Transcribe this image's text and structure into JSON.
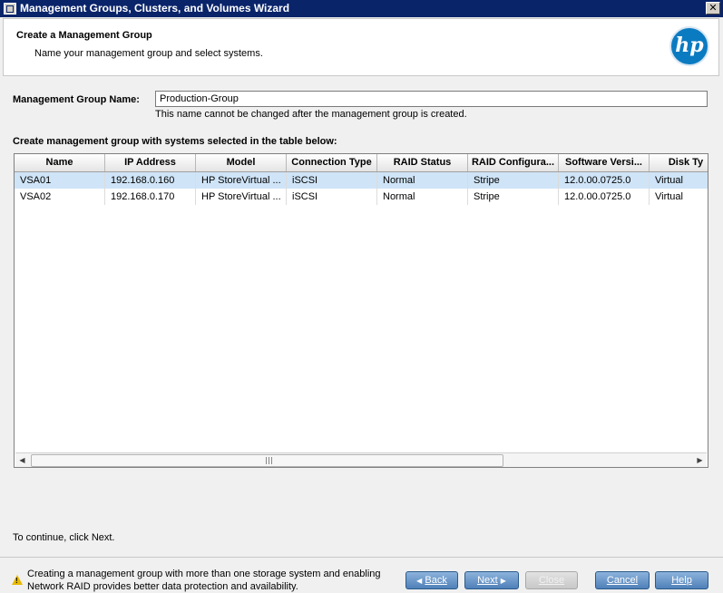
{
  "window": {
    "title": "Management Groups, Clusters, and Volumes Wizard",
    "close_glyph": "✕"
  },
  "header": {
    "title": "Create a Management Group",
    "subtitle": "Name your management group and select systems.",
    "logo_text": "hp"
  },
  "form": {
    "mg_name_label": "Management Group Name:",
    "mg_name_value": "Production-Group",
    "mg_name_hint": "This name cannot be changed after the management group is created.",
    "table_label": "Create management group with systems selected in the table below:"
  },
  "table": {
    "columns": [
      "Name",
      "IP Address",
      "Model",
      "Connection Type",
      "RAID Status",
      "RAID Configura...",
      "Software Versi...",
      "Disk Ty"
    ],
    "rows": [
      [
        "VSA01",
        "192.168.0.160",
        "HP StoreVirtual ...",
        "iSCSI",
        "Normal",
        "Stripe",
        "12.0.00.0725.0",
        "Virtual"
      ],
      [
        "VSA02",
        "192.168.0.170",
        "HP StoreVirtual ...",
        "iSCSI",
        "Normal",
        "Stripe",
        "12.0.00.0725.0",
        "Virtual"
      ]
    ],
    "selected_row": 0,
    "scroll_left_glyph": "◀",
    "scroll_right_glyph": "▶"
  },
  "continue_text": "To continue, click Next.",
  "footer": {
    "notice": "Creating a management group with more than one storage system and enabling Network RAID provides better data protection and availability.",
    "warning_icon": "warning-triangle-icon",
    "warning_mark": "!",
    "back_label": "Back",
    "next_label": "Next",
    "close_label": "Close",
    "cancel_label": "Cancel",
    "help_label": "Help",
    "back_glyph": "◀",
    "next_glyph": "▶"
  },
  "colors": {
    "title_bar": "#0a246a",
    "selection": "#cfe4f7",
    "button": "#5a8ac0",
    "logo": "#0b7bc1"
  }
}
